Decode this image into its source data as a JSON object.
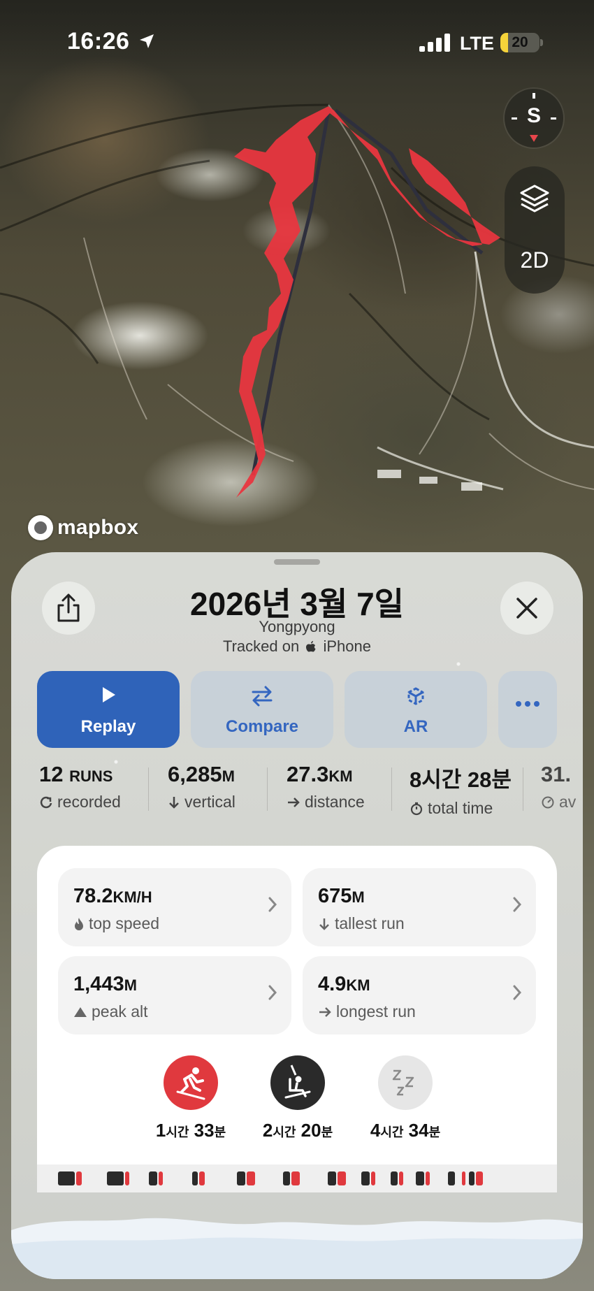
{
  "status_bar": {
    "time": "16:26",
    "network": "LTE",
    "battery": "20"
  },
  "map": {
    "compass_heading": "S",
    "mode_toggle": "2D",
    "attribution": "mapbox",
    "track_color": "#e8363f",
    "lift_color": "#2e2f3d"
  },
  "sheet": {
    "title": "2026년 3월 7일",
    "resort": "Yongpyong",
    "tracked_prefix": "Tracked on",
    "device": "iPhone",
    "actions": [
      {
        "label": "Replay",
        "icon": "play-icon"
      },
      {
        "label": "Compare",
        "icon": "compare-arrows-icon"
      },
      {
        "label": "AR",
        "icon": "ar-icon"
      },
      {
        "label": "",
        "icon": "more-icon"
      }
    ],
    "stats": [
      {
        "value": "12",
        "unit": "RUNS",
        "label": "recorded",
        "icon": "refresh-icon"
      },
      {
        "value": "6,285",
        "unit": "M",
        "label": "vertical",
        "icon": "arrow-down-icon"
      },
      {
        "value": "27.3",
        "unit": "KM",
        "label": "distance",
        "icon": "arrow-right-icon"
      },
      {
        "value": "8시간 28분",
        "unit": "",
        "label": "total time",
        "icon": "stopwatch-icon"
      },
      {
        "value": "31.",
        "unit": "",
        "label": "av",
        "icon": "gauge-icon"
      }
    ],
    "highlights": [
      {
        "value": "78.2",
        "unit": "KM/H",
        "label": "top speed",
        "icon": "flame-icon"
      },
      {
        "value": "675",
        "unit": "M",
        "label": "tallest run",
        "icon": "arrow-down-icon"
      },
      {
        "value": "1,443",
        "unit": "M",
        "label": "peak alt",
        "icon": "mountain-icon"
      },
      {
        "value": "4.9",
        "unit": "KM",
        "label": "longest run",
        "icon": "arrow-right-icon"
      }
    ],
    "time_breakdown": [
      {
        "hours": "1",
        "h_unit": "시간",
        "minutes": "33",
        "m_unit": "분",
        "icon": "skier-icon",
        "color": "#e0393e"
      },
      {
        "hours": "2",
        "h_unit": "시간",
        "minutes": "20",
        "m_unit": "분",
        "icon": "chairlift-icon",
        "color": "#2a2a2a"
      },
      {
        "hours": "4",
        "h_unit": "시간",
        "minutes": "34",
        "m_unit": "분",
        "icon": "sleep-icon",
        "color": "#e6e6e6"
      }
    ]
  }
}
